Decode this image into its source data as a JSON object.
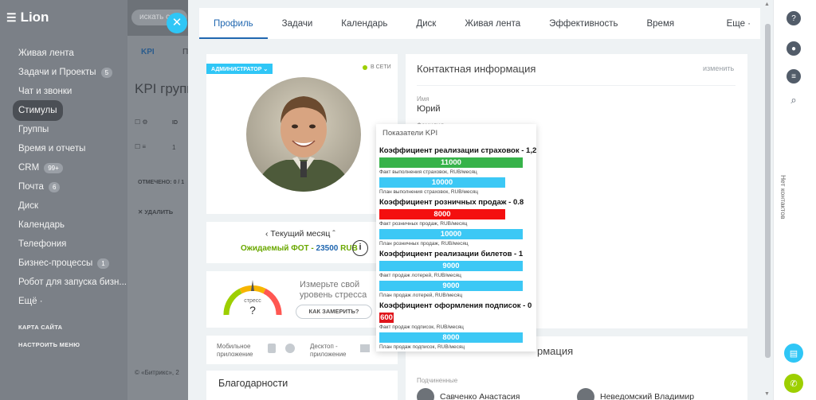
{
  "logo": "Lion",
  "search_placeholder": "искать с",
  "sidebar": {
    "items": [
      {
        "label": "Живая лента",
        "badge": ""
      },
      {
        "label": "Задачи и Проекты",
        "badge": "5"
      },
      {
        "label": "Чат и звонки",
        "badge": ""
      },
      {
        "label": "Стимулы",
        "badge": "",
        "active": true
      },
      {
        "label": "Группы",
        "badge": ""
      },
      {
        "label": "Время и отчеты",
        "badge": ""
      },
      {
        "label": "CRM",
        "badge": "99+"
      },
      {
        "label": "Почта",
        "badge": "6"
      },
      {
        "label": "Диск",
        "badge": ""
      },
      {
        "label": "Календарь",
        "badge": ""
      },
      {
        "label": "Телефония",
        "badge": ""
      },
      {
        "label": "Бизнес-процессы",
        "badge": "1"
      },
      {
        "label": "Робот для запуска бизн...",
        "badge": ""
      },
      {
        "label": "Ещё ·",
        "badge": ""
      }
    ],
    "site_map": "КАРТА САЙТА",
    "configure_menu": "НАСТРОИТЬ МЕНЮ"
  },
  "background": {
    "tab_kpi": "KPI",
    "tab_p": "П",
    "page_title": "KPI групп",
    "col_id": "ID",
    "row_id": "1",
    "selected": "ОТМЕЧЕНО: 0 / 1",
    "delete": "УДАЛИТЬ",
    "footer": "© «Битрикс», 2"
  },
  "tabs": [
    "Профиль",
    "Задачи",
    "Календарь",
    "Диск",
    "Живая лента",
    "Эффективность",
    "Время",
    "Еще ·"
  ],
  "profile": {
    "admin_tag": "АДМИНИСТРАТОР",
    "status": "В СЕТИ",
    "current_month": "Текущий месяц",
    "expected_fot_label": "Ожидаемый ФОТ - ",
    "expected_fot_value": "23500",
    "expected_fot_currency": " RUB",
    "info": "i",
    "stress_title": "Измерьте свой уровень стресса",
    "stress_label": "стресс",
    "stress_value": "?",
    "measure_button": "КАК ЗАМЕРИТЬ?",
    "mobile_app": "Мобильное приложение",
    "desktop_app": "Десктоп - приложение",
    "thanks": "Благодарности"
  },
  "contact": {
    "title": "Контактная информация",
    "edit": "изменить",
    "name_label": "Имя",
    "name_value": "Юрий",
    "surname_label": "Фамилия"
  },
  "kpi": {
    "title": "Показатели KPI",
    "groups": [
      {
        "heading": "Коэффициент реализации страховок - 1,2",
        "fact_value": "11000",
        "fact_color": "#37b34a",
        "fact_caption": "Факт выполнения страховок, RUB/месяц",
        "fact_fraction": 1.0,
        "plan_value": "10000",
        "plan_caption": "План выполнения страховок, RUB/месяц",
        "plan_fraction": 0.88
      },
      {
        "heading": "Коэффициент розничных продаж - 0.8",
        "fact_value": "8000",
        "fact_color": "#f40f0f",
        "fact_caption": "Факт розничных продаж, RUB/месяц",
        "fact_fraction": 0.88,
        "plan_value": "10000",
        "plan_caption": "План розничных продаж, RUB/месяц",
        "plan_fraction": 1.0
      },
      {
        "heading": "Коэффициент реализации билетов - 1",
        "fact_value": "9000",
        "fact_color": "#3cc8f5",
        "fact_caption": "Факт продаж лотерей, RUB/месяц",
        "fact_fraction": 1.0,
        "plan_value": "9000",
        "plan_caption": "План продаж лотерей, RUB/месяц",
        "plan_fraction": 1.0
      },
      {
        "heading": "Коэффициент оформления подписок - 0",
        "fact_value": "600",
        "fact_color": "#e0151b",
        "fact_caption": "Факт продаж подписок, RUB/месяц",
        "fact_fraction": 0.1,
        "plan_value": "8000",
        "plan_caption": "План продаж подписок, RUB/месяц",
        "plan_fraction": 1.0
      }
    ],
    "plan_color": "#3cc8f5"
  },
  "extra_section_tail": "рмация",
  "subordinates": {
    "title": "Подчиненные",
    "people": [
      "Савченко Анастасия",
      "Неведомский Владимир"
    ]
  },
  "right_bar": {
    "no_contacts": "Нет контактов"
  },
  "colors": {
    "accent": "#2067b0",
    "cyan": "#2fc6f6",
    "green_fot": "#6aa800"
  }
}
